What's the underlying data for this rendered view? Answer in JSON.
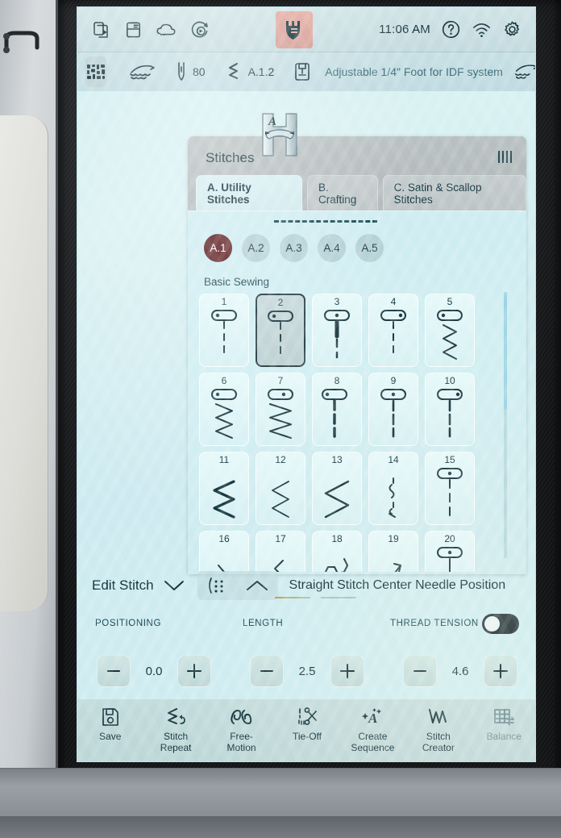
{
  "device": {
    "brand_icon": "husqvarna-viking-crown-icon",
    "screen_label": "sewing-machine-touchscreen"
  },
  "statusbar": {
    "left_icons": [
      {
        "name": "file-transfer-icon"
      },
      {
        "name": "manual-book-icon"
      },
      {
        "name": "cloud-icon"
      },
      {
        "name": "update-refresh-icon"
      }
    ],
    "clock": "11:06 AM",
    "right_icons": [
      {
        "name": "help-question-icon"
      },
      {
        "name": "wifi-icon"
      },
      {
        "name": "settings-gear-icon"
      }
    ]
  },
  "infobar": {
    "chip_icon": "stitch-plate-icon",
    "feed_dog_icon": "feed-teeth-icon",
    "needle_icon": "needle-icon",
    "needle_value": "80",
    "stitch_icon": "zigzag-stitch-icon",
    "stitch_value": "A.1.2",
    "foot_icon": "presser-foot-icon",
    "foot_text": "Adjustable 1/4\" Foot for IDF system",
    "idf_icon": "idf-feed-icon",
    "chevron_icon": "chevron-down-icon"
  },
  "dialog": {
    "title": "Stitches",
    "grip_icon": "drag-grip-icon",
    "foot_badge_icon": "presser-foot-a-icon",
    "tabs": [
      {
        "label": "A. Utility Stitches",
        "active": true
      },
      {
        "label": "B. Crafting",
        "active": false
      },
      {
        "label": "C. Satin & Scallop Stitches",
        "active": false
      }
    ],
    "pills": [
      {
        "label": "A.1",
        "active": true
      },
      {
        "label": "A.2",
        "active": false
      },
      {
        "label": "A.3",
        "active": false
      },
      {
        "label": "A.4",
        "active": false
      },
      {
        "label": "A.5",
        "active": false
      }
    ],
    "section_label": "Basic Sewing",
    "stitches": [
      {
        "num": "1",
        "art": "straight-dashed",
        "selected": false
      },
      {
        "num": "2",
        "art": "straight-dashed",
        "selected": true
      },
      {
        "num": "3",
        "art": "straight-reinforced",
        "selected": false
      },
      {
        "num": "4",
        "art": "straight-right",
        "selected": false
      },
      {
        "num": "5",
        "art": "zigzag-narrow",
        "selected": false
      },
      {
        "num": "6",
        "art": "zigzag-medium",
        "selected": false
      },
      {
        "num": "7",
        "art": "zigzag-wide",
        "selected": false
      },
      {
        "num": "8",
        "art": "straight-left-thick",
        "selected": false
      },
      {
        "num": "9",
        "art": "straight-center-dashed",
        "selected": false
      },
      {
        "num": "10",
        "art": "straight-right-dashed",
        "selected": false
      },
      {
        "num": "11",
        "art": "zigzag-bold",
        "selected": false
      },
      {
        "num": "12",
        "art": "zigzag-thin",
        "selected": false
      },
      {
        "num": "13",
        "art": "zigzag-open",
        "selected": false
      },
      {
        "num": "14",
        "art": "stretch-dashed",
        "selected": false
      },
      {
        "num": "15",
        "art": "straight-needle-down",
        "selected": false
      },
      {
        "num": "16",
        "art": "blind-hem",
        "selected": false
      },
      {
        "num": "17",
        "art": "elastic-blind-hem",
        "selected": false
      },
      {
        "num": "18",
        "art": "honeycomb",
        "selected": false
      },
      {
        "num": "19",
        "art": "cross-stretch",
        "selected": false
      },
      {
        "num": "20",
        "art": "straight-center",
        "selected": false
      }
    ],
    "side_tools": [
      {
        "name": "alert-triangle-icon",
        "active": false
      },
      {
        "name": "stitch-selection-icon",
        "active": true
      },
      {
        "name": "folder-save-icon",
        "active": false
      }
    ]
  },
  "editbar": {
    "label": "Edit Stitch",
    "chevron_icon": "chevron-down-icon",
    "dots_icon": "stitch-density-icon",
    "caret_icon": "chevron-up-icon",
    "stitch_name": "Straight Stitch Center Needle Position"
  },
  "parameters": [
    {
      "label": "POSITIONING",
      "value": "0.0",
      "minus": "−",
      "plus": "+"
    },
    {
      "label": "LENGTH",
      "value": "2.5",
      "minus": "−",
      "plus": "+"
    },
    {
      "label": "THREAD TENSION",
      "value": "4.6",
      "minus": "−",
      "plus": "+"
    }
  ],
  "thread_tension_toggle": {
    "name": "thread-tension-toggle",
    "state": "off"
  },
  "bottombar": [
    {
      "label": "Save",
      "icon": "save-disk-icon",
      "disabled": false
    },
    {
      "label": "Stitch\nRepeat",
      "icon": "stitch-repeat-icon",
      "disabled": false
    },
    {
      "label": "Free-\nMotion",
      "icon": "free-motion-icon",
      "disabled": false
    },
    {
      "label": "Tie-Off",
      "icon": "tie-off-scissors-icon",
      "disabled": false
    },
    {
      "label": "Create\nSequence",
      "icon": "create-sequence-icon",
      "disabled": false
    },
    {
      "label": "Stitch\nCreator",
      "icon": "stitch-creator-icon",
      "disabled": false
    },
    {
      "label": "Balance",
      "icon": "balance-grid-icon",
      "disabled": true
    }
  ],
  "colors": {
    "screen_bg": "#cfeef2",
    "accent_dark_red": "#5a1a20",
    "brand_button": "#d49a94",
    "text_primary": "#12313c",
    "text_dim": "#6e8e96",
    "dialog_chrome": "#b2babc"
  }
}
